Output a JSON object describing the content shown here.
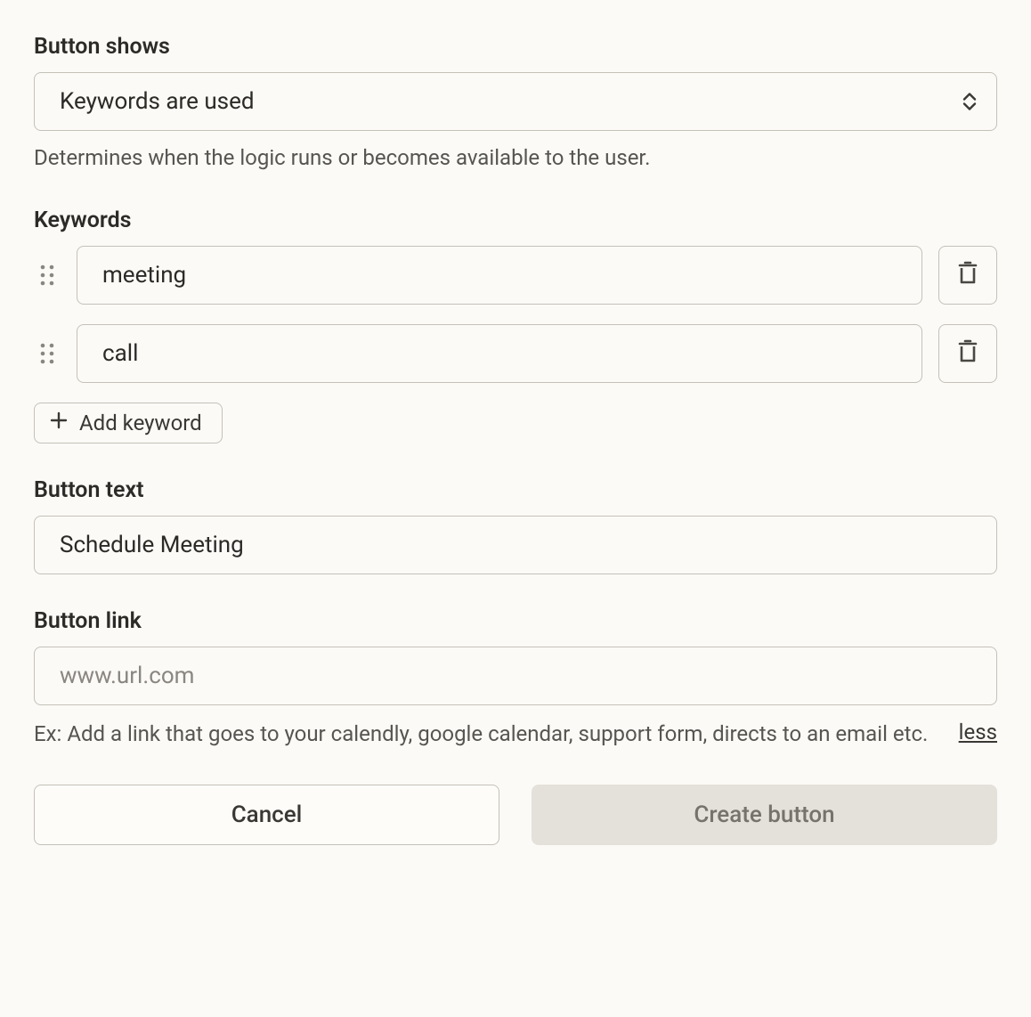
{
  "button_shows": {
    "label": "Button shows",
    "value": "Keywords are used",
    "help": "Determines when the logic runs or becomes available to the user."
  },
  "keywords": {
    "label": "Keywords",
    "items": [
      {
        "value": "meeting"
      },
      {
        "value": "call"
      }
    ],
    "add_label": "Add keyword"
  },
  "button_text": {
    "label": "Button text",
    "value": "Schedule Meeting"
  },
  "button_link": {
    "label": "Button link",
    "value": "",
    "placeholder": "www.url.com",
    "help": "Ex: Add a link that goes to your calendly, google calendar, support form, directs to an email etc.",
    "less_label": "less"
  },
  "footer": {
    "cancel": "Cancel",
    "create": "Create button"
  }
}
